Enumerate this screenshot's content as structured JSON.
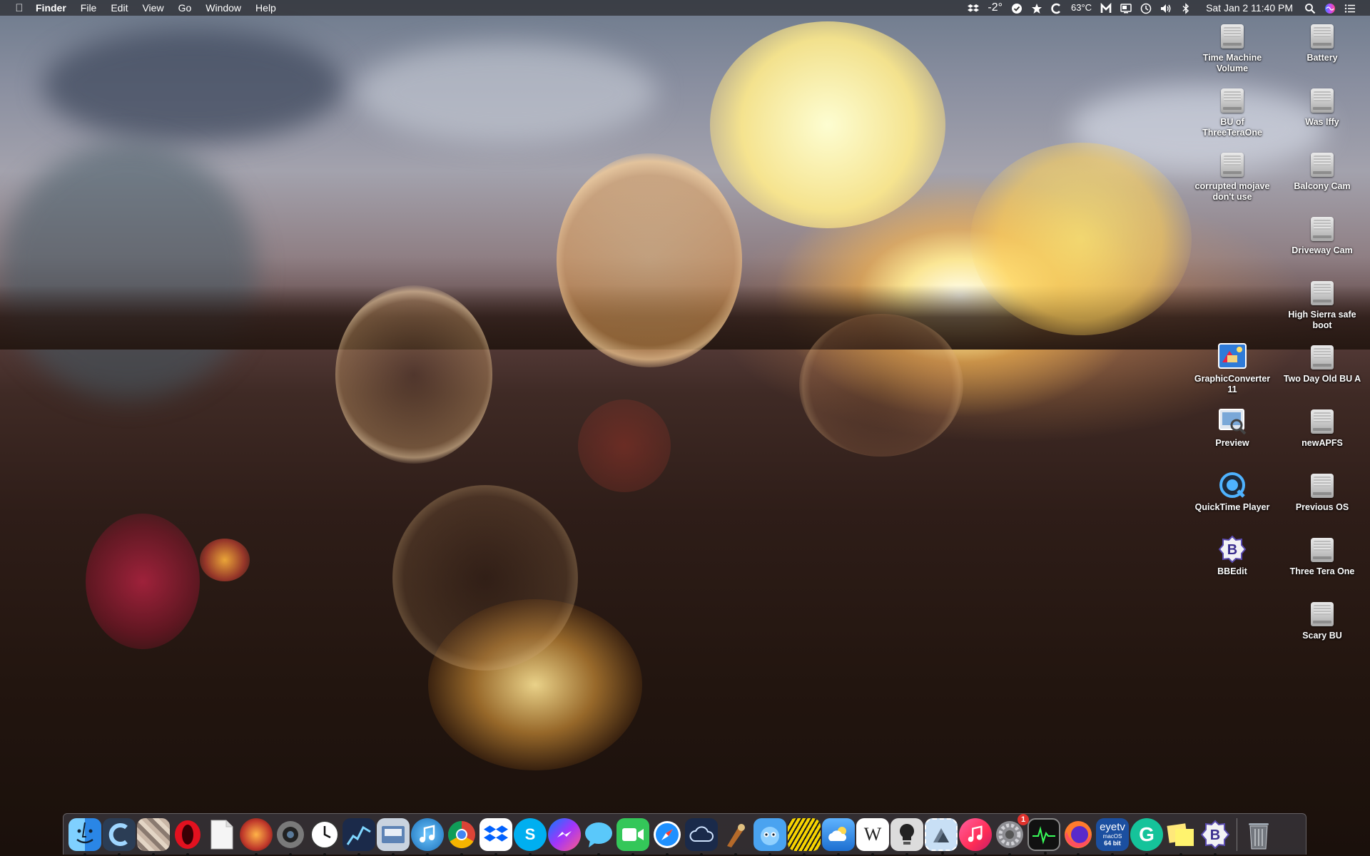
{
  "menubar": {
    "app_name": "Finder",
    "menus": [
      "File",
      "Edit",
      "View",
      "Go",
      "Window",
      "Help"
    ],
    "status": {
      "weather": "-2°",
      "cpu_temp": "63°C",
      "datetime": "Sat Jan 2  11:40 PM"
    }
  },
  "desktop_icons": {
    "col_right": [
      {
        "label": "Battery"
      },
      {
        "label": "Was Iffy"
      },
      {
        "label": "Balcony Cam"
      },
      {
        "label": "Driveway Cam"
      },
      {
        "label": "High Sierra safe boot"
      },
      {
        "label": "Two Day Old BU A"
      },
      {
        "label": "newAPFS"
      },
      {
        "label": "Previous OS"
      },
      {
        "label": "Three Tera One"
      },
      {
        "label": "Scary BU"
      }
    ],
    "col_left": [
      {
        "label": "Time Machine Volume"
      },
      {
        "label": "BU of ThreeTeraOne"
      },
      {
        "label": "corrupted mojave don't use"
      },
      {
        "label": "GraphicConverter 11"
      },
      {
        "label": "Preview"
      },
      {
        "label": "QuickTime Player"
      },
      {
        "label": "BBEdit"
      }
    ]
  },
  "dock": {
    "eyetv_text": "eyetv",
    "eyetv_sub": "macOS",
    "eyetv_bits": "64 bit",
    "system_prefs_badge": "1",
    "wikipedia_glyph": "W",
    "skype_glyph": "S",
    "grammarly_glyph": "G",
    "bbedit_glyph": "B"
  },
  "colors": {
    "menubar_bg": "#2a2a2e",
    "dock_bg": "#464650"
  }
}
